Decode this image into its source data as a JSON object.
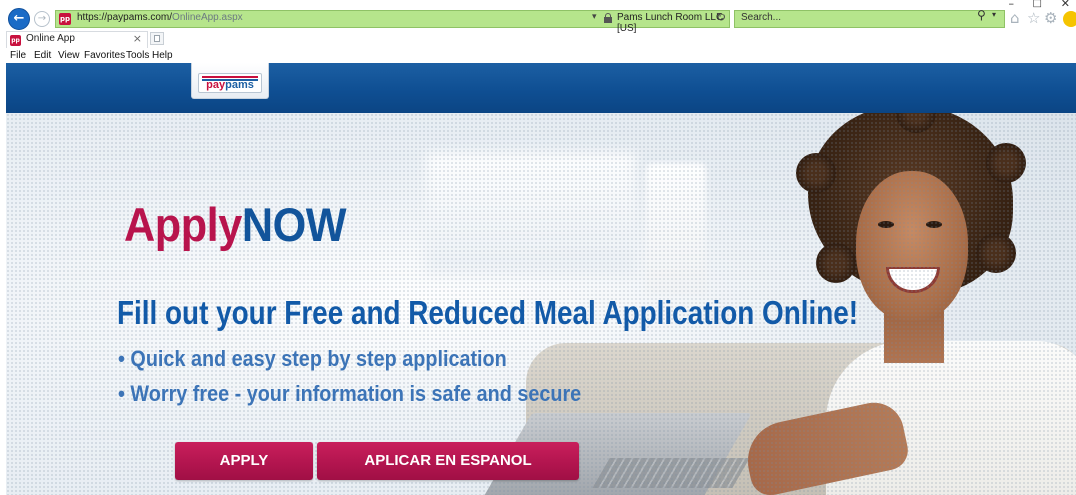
{
  "browser": {
    "url_host": "https://paypams.com/",
    "url_path": "OnlineApp.aspx",
    "favicon_text": "pp",
    "certificate_label": "Pams Lunch Room LLC [US]",
    "search_placeholder": "Search...",
    "tab_title": "Online App",
    "menu": [
      "File",
      "Edit",
      "View",
      "Favorites",
      "Tools",
      "Help"
    ],
    "window_controls": {
      "minimize": "–",
      "maximize": "□",
      "close": "✕"
    }
  },
  "site": {
    "logo": {
      "pay": "pay",
      "pams": "pams"
    },
    "headline": {
      "apply": "Apply",
      "now": "NOW"
    },
    "subheadline": "Fill out your Free and Reduced Meal Application Online!",
    "bullets": [
      "• Quick and easy step by step application",
      "• Worry free - your information is safe and secure"
    ],
    "buttons": {
      "apply": "APPLY",
      "espanol": "APLICAR EN ESPANOL"
    }
  },
  "colors": {
    "header_blue": "#0f4f93",
    "apply_pink": "#b8144d",
    "now_blue": "#12549b",
    "button_crimson": "#b3154f",
    "address_bar_green": "#b6e58c"
  }
}
